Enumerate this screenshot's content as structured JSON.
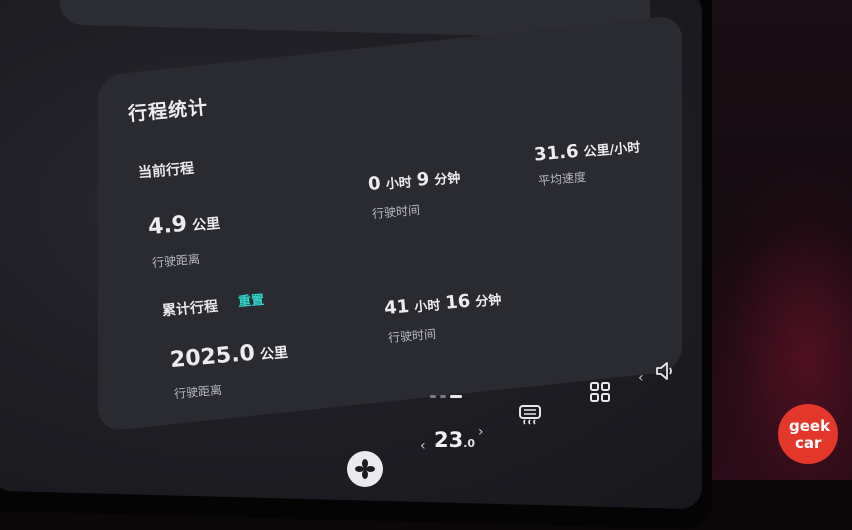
{
  "trip_stats": {
    "title": "行程统计",
    "current": {
      "heading": "当前行程",
      "distance_value": "4.9",
      "distance_unit": "公里",
      "distance_label": "行驶距离",
      "time_hours": "0",
      "time_hours_unit": "小时",
      "time_minutes": "9",
      "time_minutes_unit": "分钟",
      "time_label": "行驶时间",
      "speed_value": "31.6",
      "speed_unit": "公里/小时",
      "speed_label": "平均速度"
    },
    "cumulative": {
      "heading": "累计行程",
      "reset_label": "重置",
      "distance_value": "2025.0",
      "distance_unit": "公里",
      "distance_label": "行驶距离",
      "time_hours": "41",
      "time_hours_unit": "小时",
      "time_minutes": "16",
      "time_minutes_unit": "分钟",
      "time_label": "行驶时间"
    }
  },
  "pager": {
    "pages": 3,
    "active": 2
  },
  "bottom_bar": {
    "temperature": "23",
    "temperature_decimal": ".0",
    "decrease_glyph": "‹",
    "increase_glyph": "›",
    "volume_prev_glyph": "‹"
  },
  "watermark": {
    "line1": "geek",
    "line2": "car"
  },
  "colors": {
    "accent": "#2fd2c8",
    "logo": "#e4372c"
  }
}
